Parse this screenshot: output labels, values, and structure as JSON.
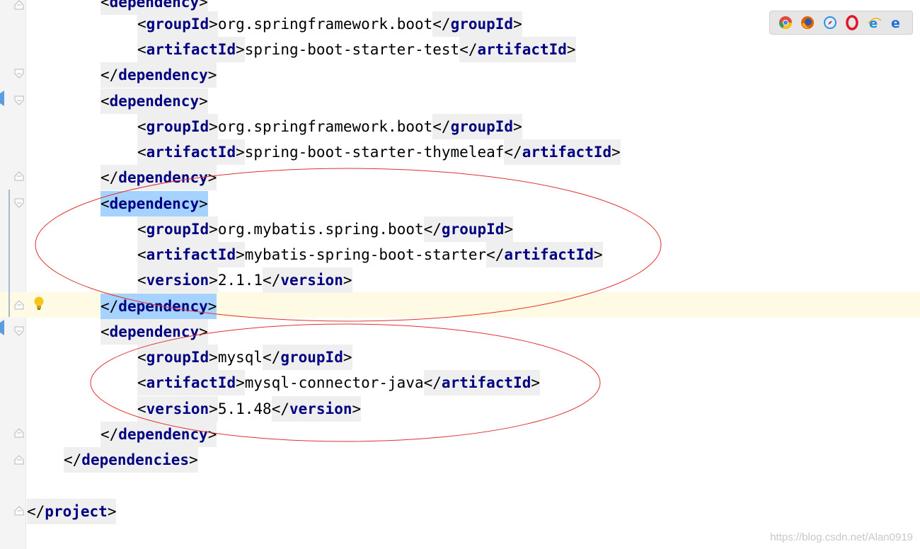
{
  "editor": {
    "lines": [
      {
        "parts": [
          {
            "open": true,
            "name": "dependency",
            "close": false
          }
        ],
        "suffix": "",
        "cut": true
      },
      {
        "parts": [
          {
            "open": true,
            "name": "groupId"
          },
          {
            "text": "org.springframework.boot"
          },
          {
            "open": false,
            "name": "groupId"
          }
        ]
      },
      {
        "parts": [
          {
            "open": true,
            "name": "artifactId"
          },
          {
            "text": "spring-boot-starter-test"
          },
          {
            "open": false,
            "name": "artifactId"
          }
        ]
      },
      {
        "parts": [
          {
            "open": false,
            "name": "dependency"
          }
        ]
      },
      {
        "parts": [
          {
            "open": true,
            "name": "dependency"
          }
        ]
      },
      {
        "parts": [
          {
            "open": true,
            "name": "groupId"
          },
          {
            "text": "org.springframework.boot"
          },
          {
            "open": false,
            "name": "groupId"
          }
        ]
      },
      {
        "parts": [
          {
            "open": true,
            "name": "artifactId"
          },
          {
            "text": "spring-boot-starter-thymeleaf"
          },
          {
            "open": false,
            "name": "artifactId"
          }
        ]
      },
      {
        "parts": [
          {
            "open": false,
            "name": "dependency"
          }
        ]
      },
      {
        "parts": [
          {
            "open": true,
            "name": "dependency"
          }
        ]
      },
      {
        "parts": [
          {
            "open": true,
            "name": "groupId"
          },
          {
            "text": "org.mybatis.spring.boot"
          },
          {
            "open": false,
            "name": "groupId"
          }
        ]
      },
      {
        "parts": [
          {
            "open": true,
            "name": "artifactId"
          },
          {
            "text": "mybatis-spring-boot-starter"
          },
          {
            "open": false,
            "name": "artifactId"
          }
        ]
      },
      {
        "parts": [
          {
            "open": true,
            "name": "version"
          },
          {
            "text": "2.1.1"
          },
          {
            "open": false,
            "name": "version"
          }
        ]
      },
      {
        "parts": [
          {
            "open": false,
            "name": "dependency"
          }
        ]
      },
      {
        "parts": [
          {
            "open": true,
            "name": "dependency"
          }
        ]
      },
      {
        "parts": [
          {
            "open": true,
            "name": "groupId"
          },
          {
            "text": "mysql"
          },
          {
            "open": false,
            "name": "groupId"
          }
        ]
      },
      {
        "parts": [
          {
            "open": true,
            "name": "artifactId"
          },
          {
            "text": "mysql-connector-java"
          },
          {
            "open": false,
            "name": "artifactId"
          }
        ]
      },
      {
        "parts": [
          {
            "open": true,
            "name": "version"
          },
          {
            "text": "5.1.48"
          },
          {
            "open": false,
            "name": "version"
          }
        ]
      },
      {
        "parts": [
          {
            "open": false,
            "name": "dependency"
          }
        ]
      },
      {
        "parts": [
          {
            "open": false,
            "name": "dependencies"
          }
        ]
      },
      {
        "parts": []
      },
      {
        "parts": [
          {
            "open": false,
            "name": "project"
          }
        ]
      }
    ]
  },
  "browser_icons": [
    "chrome-icon",
    "firefox-icon",
    "safari-icon",
    "opera-icon",
    "ie-icon",
    "edge-icon"
  ],
  "watermark": "https://blog.csdn.net/Alan0919",
  "colors": {
    "tag": "#000080",
    "selection": "#a6d2ff",
    "annotation": "#e03030",
    "current_line": "#fffae3"
  }
}
